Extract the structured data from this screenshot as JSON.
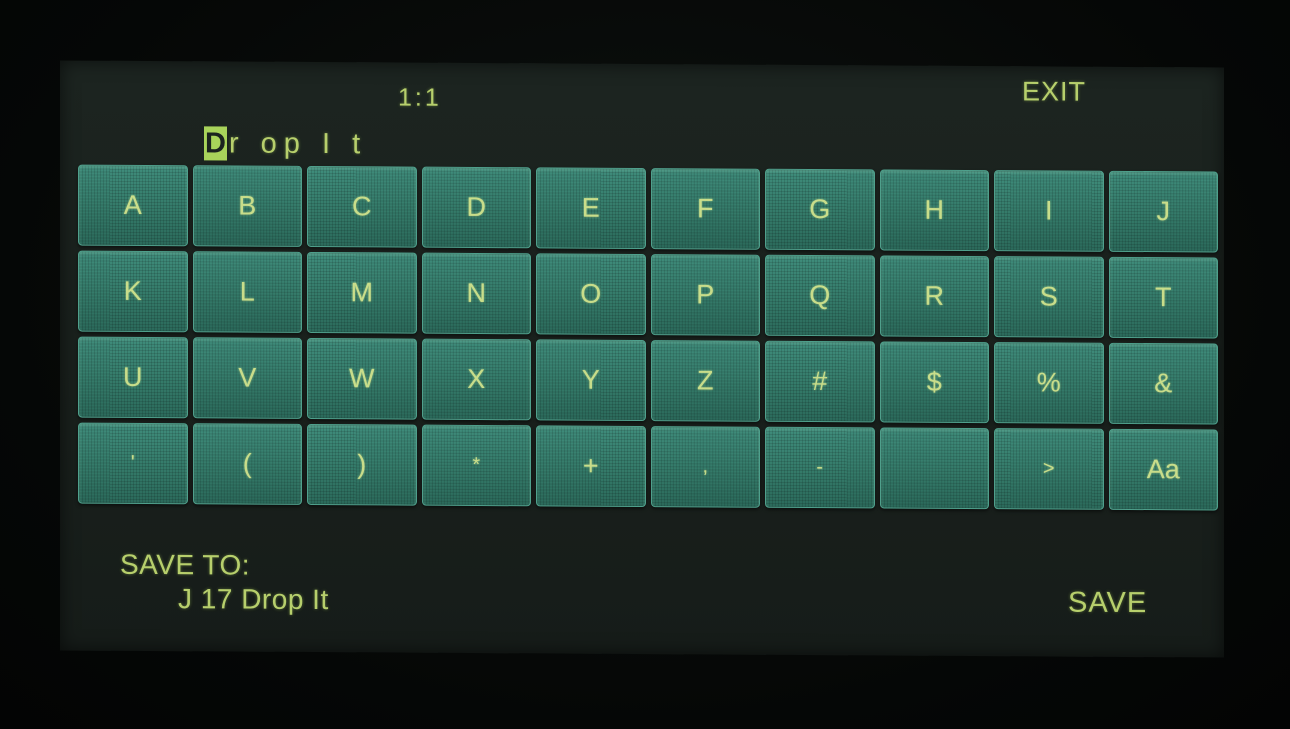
{
  "header": {
    "position": "1:1",
    "exit_label": "EXIT"
  },
  "name_field": {
    "cursor_char": "D",
    "rest": "r op  I t"
  },
  "keyboard": {
    "rows": [
      [
        "A",
        "B",
        "C",
        "D",
        "E",
        "F",
        "G",
        "H",
        "I",
        "J"
      ],
      [
        "K",
        "L",
        "M",
        "N",
        "O",
        "P",
        "Q",
        "R",
        "S",
        "T"
      ],
      [
        "U",
        "V",
        "W",
        "X",
        "Y",
        "Z",
        "#",
        "$",
        "%",
        "&"
      ],
      [
        "'",
        "(",
        ")",
        "*",
        "+",
        ",",
        "-",
        "",
        ">",
        "Aa"
      ]
    ]
  },
  "footer": {
    "save_to_label": "SAVE TO:",
    "save_to_value": "J 17 Drop It",
    "save_label": "SAVE"
  },
  "colors": {
    "lcd_text": "#b7cf6c",
    "key_fill": "#347a69",
    "cursor_highlight": "#a8d35a",
    "screen_background": "#1a211d"
  }
}
